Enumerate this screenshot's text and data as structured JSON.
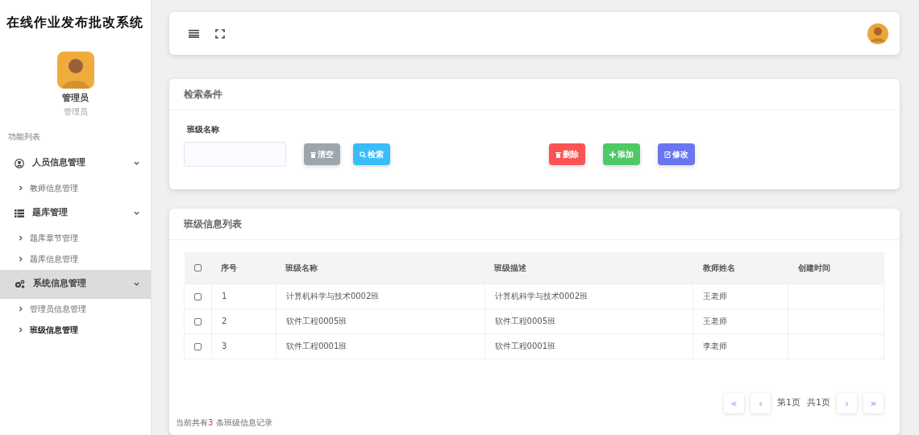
{
  "app_title": "在线作业发布批改系统",
  "user": {
    "name": "管理员",
    "role": "管理员"
  },
  "menu_heading": "功能列表",
  "menu": [
    {
      "label": "人员信息管理",
      "selected": false,
      "expanded": true,
      "children": [
        {
          "label": "教师信息管理",
          "selected": false
        }
      ]
    },
    {
      "label": "题库管理",
      "selected": false,
      "expanded": true,
      "children": [
        {
          "label": "题库章节管理",
          "selected": false
        },
        {
          "label": "题库信息管理",
          "selected": false
        }
      ]
    },
    {
      "label": "系统信息管理",
      "selected": true,
      "expanded": true,
      "children": [
        {
          "label": "管理员信息管理",
          "selected": false
        },
        {
          "label": "班级信息管理",
          "selected": true
        }
      ]
    }
  ],
  "search_panel": {
    "title": "检索条件",
    "field_label": "班级名称",
    "buttons": [
      {
        "label": "清空",
        "kind": "clear"
      },
      {
        "label": "检索",
        "kind": "search"
      },
      {
        "label": "删除",
        "kind": "delete"
      },
      {
        "label": "添加",
        "kind": "add"
      },
      {
        "label": "修改",
        "kind": "edit"
      }
    ]
  },
  "list_panel": {
    "title": "班级信息列表",
    "table": {
      "select_all": {
        "checked": false
      },
      "columns": [
        "序号",
        "班级名称",
        "班级描述",
        "教师姓名",
        "创建时间"
      ],
      "rows": [
        {
          "checked": false,
          "cells": [
            "1",
            "计算机科学与技术0002班",
            "计算机科学与技术0002班",
            "王老师"
          ]
        },
        {
          "checked": false,
          "cells": [
            "2",
            "软件工程0005班",
            "软件工程0005班",
            "王老师"
          ]
        },
        {
          "checked": false,
          "cells": [
            "3",
            "软件工程0001班",
            "软件工程0001班",
            "李老师"
          ]
        }
      ]
    },
    "pagination": {
      "first": "«",
      "prev": "‹",
      "page": "第1页",
      "total": "共1页",
      "next": "›",
      "last": "»"
    },
    "record_count": {
      "prefix": "当前共有",
      "count": "3",
      "suffix": " 条班级信息记录"
    }
  }
}
